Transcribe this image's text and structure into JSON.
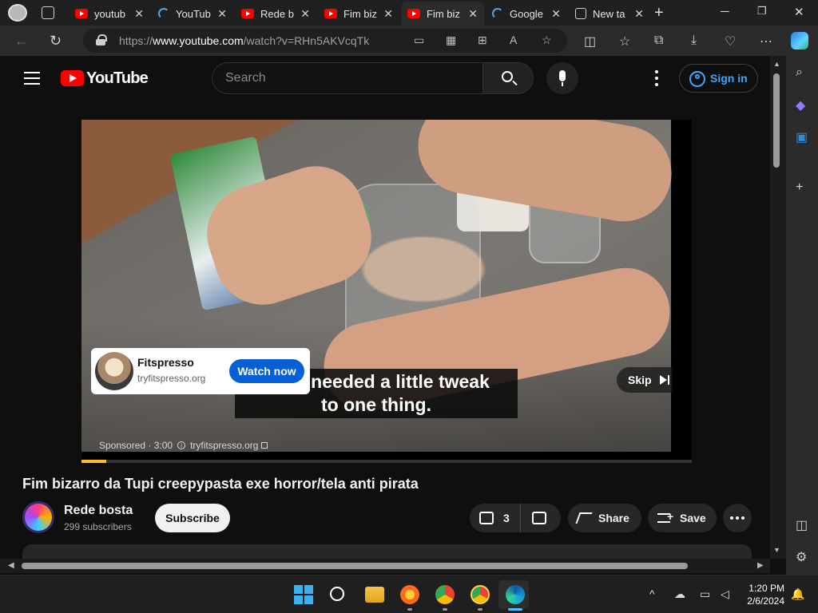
{
  "browser": {
    "tabs": [
      {
        "label": "youtub",
        "favicon": "youtube-favicon",
        "active": false
      },
      {
        "label": "YouTub",
        "favicon": "loading-spinner",
        "active": false
      },
      {
        "label": "Rede b",
        "favicon": "youtube-favicon",
        "active": false
      },
      {
        "label": "Fim biz",
        "favicon": "youtube-favicon",
        "active": false
      },
      {
        "label": "Fim biz",
        "favicon": "youtube-favicon",
        "active": true
      },
      {
        "label": "Google",
        "favicon": "loading-spinner",
        "active": false
      },
      {
        "label": "New ta",
        "favicon": "newtab-icon",
        "active": false
      }
    ],
    "tab_close_glyph": "✕",
    "url_prefix": "https://",
    "url_host": "www.youtube.com",
    "url_path": "/watch?v=RHn5AKVcqTk"
  },
  "youtube": {
    "logo_text": "YouTube",
    "search_placeholder": "Search",
    "sign_in_label": "Sign in"
  },
  "ad": {
    "advertiser_name": "Fitspresso",
    "advertiser_domain": "tryfitspresso.org",
    "cta_label": "Watch now",
    "skip_label": "Skip",
    "sponsored_label": "Sponsored · 3:00",
    "sponsored_domain": "tryfitspresso.org",
    "progress_fraction": 0.04
  },
  "video": {
    "caption_line1": "I just needed a little tweak",
    "caption_line2": "to one thing.",
    "title": "Fim bizarro da Tupi creepypasta exe horror/tela anti pirata"
  },
  "channel": {
    "name": "Rede bosta",
    "subscribers": "299 subscribers",
    "subscribe_label": "Subscribe"
  },
  "actions": {
    "like_count": "3",
    "share_label": "Share",
    "save_label": "Save"
  },
  "taskbar": {
    "time": "1:20 PM",
    "date": "2/6/2024"
  },
  "colors": {
    "yt_red": "#ff0000",
    "signin_blue": "#3ea6ff",
    "cta_blue": "#065fd4",
    "ad_progress": "#fbbf24"
  }
}
